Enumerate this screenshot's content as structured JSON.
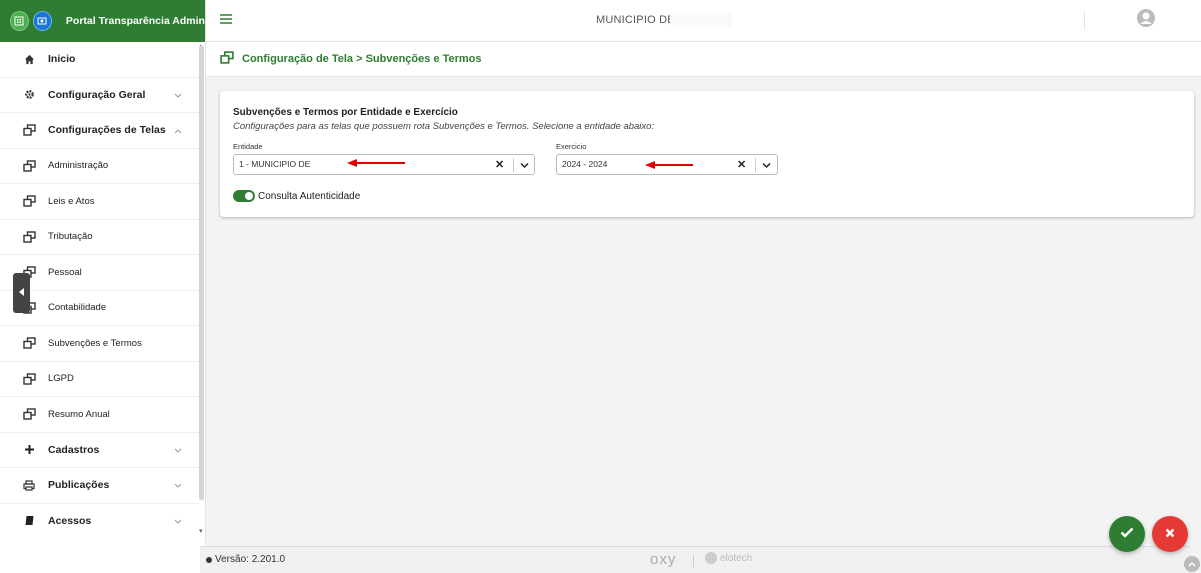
{
  "brand": {
    "title": "Portal Transparência Admin"
  },
  "sidebar": {
    "items": [
      {
        "label": "Inicio",
        "icon": "home-icon"
      },
      {
        "label": "Configuração Geral",
        "icon": "gear-icon",
        "chevron": "down"
      },
      {
        "label": "Configurações de Telas",
        "icon": "window-icon",
        "chevron": "up"
      },
      {
        "label": "Administração",
        "icon": "window-icon"
      },
      {
        "label": "Leis e Atos",
        "icon": "window-icon"
      },
      {
        "label": "Tributação",
        "icon": "window-icon"
      },
      {
        "label": "Pessoal",
        "icon": "window-icon"
      },
      {
        "label": "Contabilidade",
        "icon": "window-icon"
      },
      {
        "label": "Subvenções e Termos",
        "icon": "window-icon"
      },
      {
        "label": "LGPD",
        "icon": "window-icon"
      },
      {
        "label": "Resumo Anual",
        "icon": "window-icon"
      },
      {
        "label": "Cadastros",
        "icon": "plus-icon",
        "chevron": "down"
      },
      {
        "label": "Publicações",
        "icon": "printer-icon",
        "chevron": "down"
      },
      {
        "label": "Acessos",
        "icon": "book-icon",
        "chevron": "down"
      }
    ]
  },
  "topbar": {
    "municipio": "MUNICIPIO DE"
  },
  "page": {
    "title": "Configuração de Tela > Subvenções e Termos"
  },
  "card": {
    "title": "Subvenções e Termos por Entidade e Exercício",
    "subtitle": "Configurações para as telas que possuem rota Subvenções e Termos. Selecione a entidade abaixo:",
    "entidade_label": "Entidade",
    "entidade_value": "1 - MUNICIPIO DE",
    "exercicio_label": "Exercicio",
    "exercicio_value": "2024 - 2024",
    "toggle_label": "Consulta Autenticidade",
    "toggle_on": true
  },
  "footer": {
    "version": "Versão: 2.201.0",
    "oxy": "OXY",
    "elotech": "elotech"
  },
  "colors": {
    "primary": "#2e7d32",
    "danger": "#e53935",
    "arrow": "#e00000"
  }
}
